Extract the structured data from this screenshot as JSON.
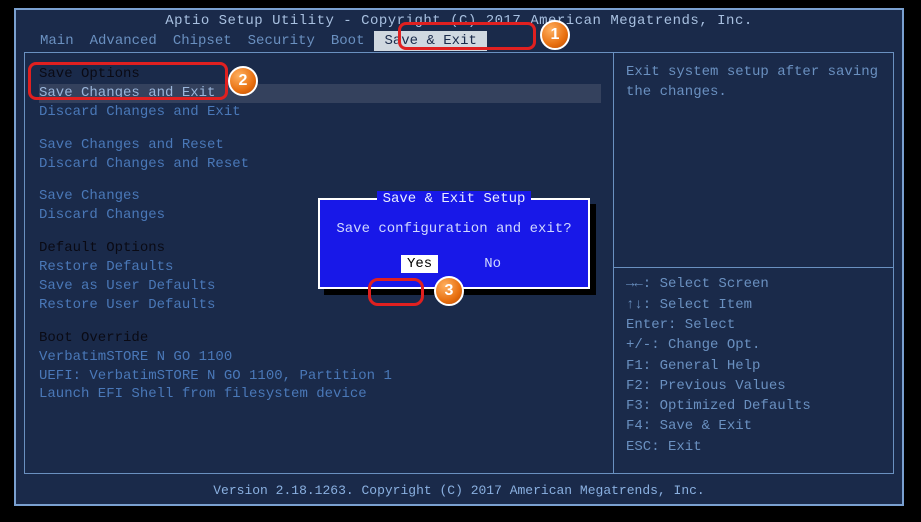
{
  "title": "Aptio Setup Utility - Copyright (C) 2017 American Megatrends, Inc.",
  "footer": "Version 2.18.1263. Copyright (C) 2017 American Megatrends, Inc.",
  "tabs": {
    "t0": "Main",
    "t1": "Advanced",
    "t2": "Chipset",
    "t3": "Security",
    "t4": "Boot",
    "t5": "Save & Exit"
  },
  "left": {
    "save_options_head": "Save Options",
    "save_exit": "Save Changes and Exit",
    "discard_exit": "Discard Changes and Exit",
    "save_reset": "Save Changes and Reset",
    "discard_reset": "Discard Changes and Reset",
    "save": "Save Changes",
    "discard": "Discard Changes",
    "default_options_head": "Default Options",
    "restore_def": "Restore Defaults",
    "save_user_def": "Save as User Defaults",
    "restore_user_def": "Restore User Defaults",
    "boot_override_head": "Boot Override",
    "boot1": "VerbatimSTORE N GO 1100",
    "boot2": "UEFI: VerbatimSTORE N GO 1100, Partition 1",
    "boot3": "Launch EFI Shell from filesystem device"
  },
  "right": {
    "help": "Exit system setup after saving the changes.",
    "k1": "→←: Select Screen",
    "k2": "↑↓: Select Item",
    "k3": "Enter: Select",
    "k4": "+/-: Change Opt.",
    "k5": "F1: General Help",
    "k6": "F2: Previous Values",
    "k7": "F3: Optimized Defaults",
    "k8": "F4: Save & Exit",
    "k9": "ESC: Exit"
  },
  "dialog": {
    "title": "Save & Exit Setup",
    "msg": "Save configuration and exit?",
    "yes": "Yes",
    "no": "No"
  },
  "annotations": {
    "n1": "1",
    "n2": "2",
    "n3": "3"
  }
}
